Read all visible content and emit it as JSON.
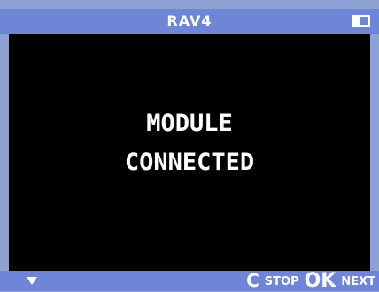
{
  "device": {
    "title": "RAV4",
    "battery_level": 0.35
  },
  "screen": {
    "message_line1": "MODULE",
    "message_line2": "CONNECTED"
  },
  "softkeys": {
    "nav_icon": "down-arrow-icon",
    "cancel_key": "C",
    "cancel_label": "STOP",
    "ok_key": "OK",
    "ok_label": "NEXT"
  },
  "colors": {
    "bar": "#6f86d8",
    "frame": "#8fa2d6",
    "screen": "#000000",
    "text": "#ffffff"
  }
}
